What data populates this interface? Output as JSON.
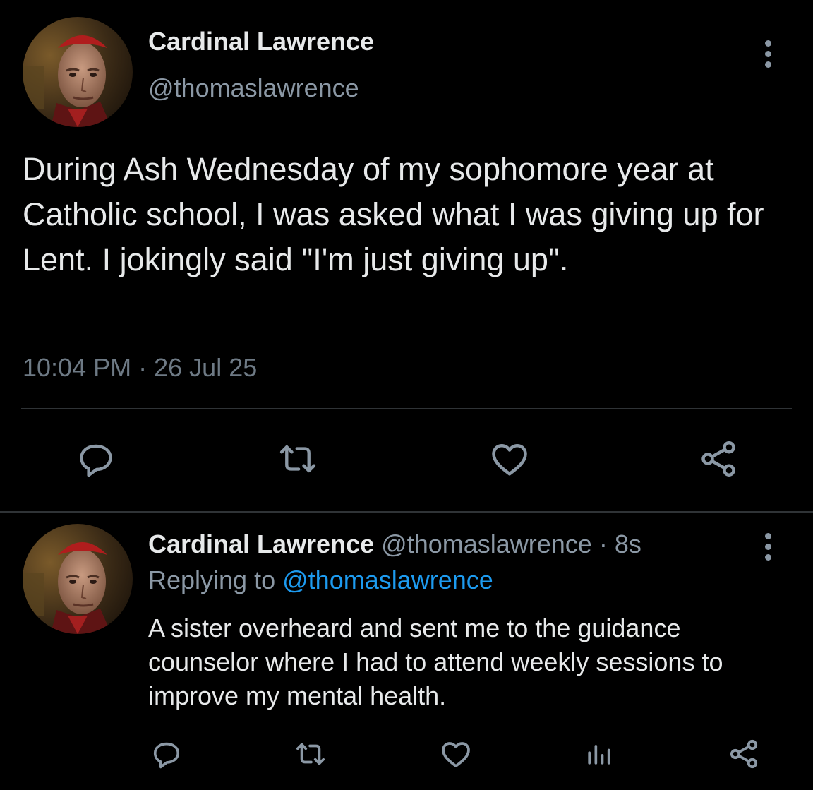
{
  "main_tweet": {
    "author_name": "Cardinal Lawrence",
    "author_handle": "@thomaslawrence",
    "text": "During Ash Wednesday of my sophomore year at Catholic school, I was asked what I was giving up for Lent. I jokingly said \"I'm just giving up\".",
    "time": "10:04 PM",
    "separator": "·",
    "date": "26 Jul 25",
    "actions": [
      "reply-icon",
      "retweet-icon",
      "like-icon",
      "share-icon"
    ]
  },
  "reply_tweet": {
    "author_name": "Cardinal Lawrence",
    "author_handle": "@thomaslawrence",
    "separator": "·",
    "age": "8s",
    "replying_prefix": "Replying to",
    "replying_to": "@thomaslawrence",
    "text": "A sister overheard and sent me to the guidance counselor where I had to attend weekly sessions to improve my mental health.",
    "actions": [
      "reply-icon",
      "retweet-icon",
      "like-icon",
      "analytics-icon",
      "share-icon"
    ]
  },
  "colors": {
    "background": "#000000",
    "text_primary": "#e7e9ea",
    "text_secondary": "#8b98a5",
    "link": "#1d9bf0",
    "divider": "#2f3336"
  }
}
